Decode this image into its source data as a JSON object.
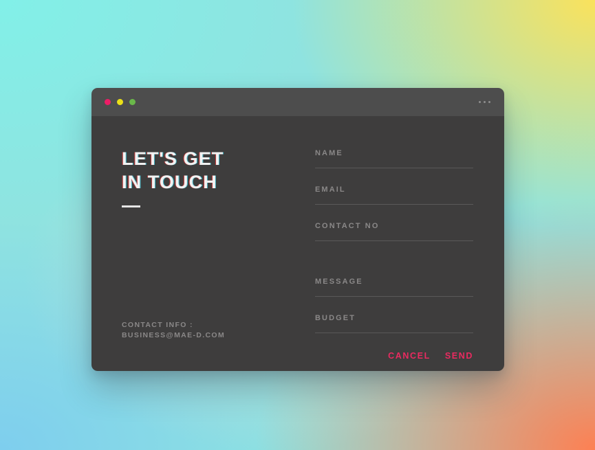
{
  "window": {
    "titlebar": {
      "dots": [
        {
          "name": "close-dot",
          "color": "#ec1d66"
        },
        {
          "name": "minimize-dot",
          "color": "#ebe018"
        },
        {
          "name": "maximize-dot",
          "color": "#6ab84a"
        }
      ],
      "menu_icon": "ellipsis-icon"
    }
  },
  "left": {
    "headline_line1": "LET'S GET",
    "headline_line2": "IN TOUCH",
    "contact_label": "CONTACT INFO :",
    "contact_email": "BUSINESS@MAE-D.COM"
  },
  "form": {
    "fields": [
      {
        "name": "name",
        "placeholder": "NAME",
        "value": ""
      },
      {
        "name": "email",
        "placeholder": "EMAIL",
        "value": ""
      },
      {
        "name": "contact_no",
        "placeholder": "CONTACT NO",
        "value": ""
      },
      {
        "name": "message",
        "placeholder": "MESSAGE",
        "value": ""
      },
      {
        "name": "budget",
        "placeholder": "BUDGET",
        "value": ""
      }
    ],
    "cancel_label": "CANCEL",
    "send_label": "SEND"
  },
  "colors": {
    "accent_pink": "#ea2a60",
    "card_body": "#3e3d3d",
    "card_titlebar": "#4d4d4d",
    "placeholder_text": "#8a8888",
    "field_underline": "#5a5959",
    "headline_text": "#f2f2f2"
  }
}
